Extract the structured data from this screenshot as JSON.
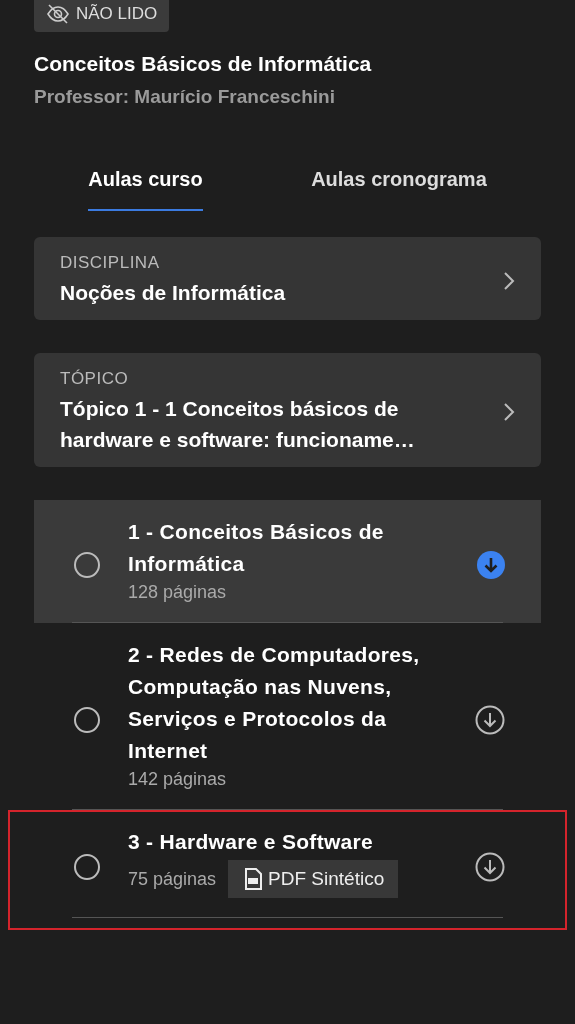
{
  "badge": {
    "label": "NÃO LIDO"
  },
  "course": {
    "title": "Conceitos Básicos de Informática",
    "professor": "Professor: Maurício Franceschini"
  },
  "tabs": [
    {
      "label": "Aulas curso",
      "selected": true
    },
    {
      "label": "Aulas cronograma",
      "selected": false
    }
  ],
  "cards": [
    {
      "caption": "DISCIPLINA",
      "value": "Noções de Informática"
    },
    {
      "caption": "TÓPICO",
      "value": "Tópico 1 - 1 Conceitos básicos de hardware e software: funcioname…"
    }
  ],
  "lessons": [
    {
      "title": "1 - Conceitos Básicos de Informática",
      "pages": "128 páginas",
      "selected": true,
      "checked": false,
      "downloaded": true,
      "highlighted": false
    },
    {
      "title": "2 - Redes de Computadores, Computação nas Nuvens, Serviços e Protocolos da Internet",
      "pages": "142 páginas",
      "selected": false,
      "checked": false,
      "downloaded": false,
      "highlighted": false
    },
    {
      "title": "3 - Hardware e Software",
      "pages": "75 páginas",
      "pdf": "PDF Sintético",
      "selected": false,
      "checked": false,
      "downloaded": false,
      "highlighted": true
    }
  ]
}
